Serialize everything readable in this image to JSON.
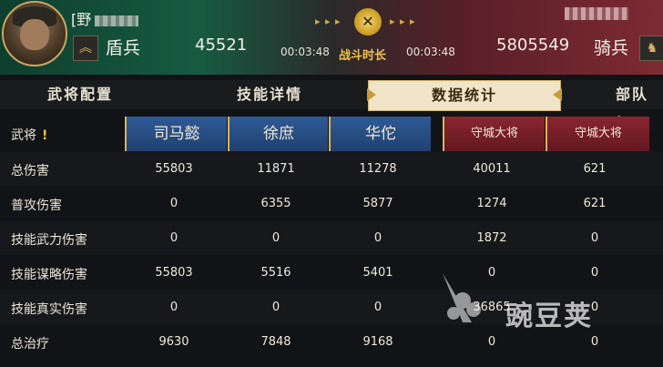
{
  "player_left": {
    "name_visible": "[野",
    "troop_icon": "chevron-icon",
    "troop": "盾兵",
    "count": "45521",
    "timer": "00:03:48"
  },
  "player_right": {
    "troop": "骑兵",
    "count": "5805549",
    "timer": "00:03:48"
  },
  "battle": {
    "label": "战斗时长",
    "arrows_left": "▸ ▸ ▸",
    "arrows_right": "▸ ▸ ▸",
    "icon": "crossed-swords-icon",
    "icon_glyph": "✕"
  },
  "tabs": [
    {
      "label": "武将配置",
      "active": false
    },
    {
      "label": "技能详情",
      "active": false
    },
    {
      "label": "数据统计",
      "active": true
    },
    {
      "label": "部队加",
      "active": false
    }
  ],
  "table": {
    "header_label": "武将",
    "header_mark": "!",
    "generals": [
      "司马懿",
      "徐庶",
      "华佗",
      "守城大将",
      "守城大将"
    ],
    "rows": [
      {
        "label": "总伤害",
        "values": [
          "55803",
          "11871",
          "11278",
          "40011",
          "621"
        ]
      },
      {
        "label": "普攻伤害",
        "values": [
          "0",
          "6355",
          "5877",
          "1274",
          "621"
        ]
      },
      {
        "label": "技能武力伤害",
        "values": [
          "0",
          "0",
          "0",
          "1872",
          "0"
        ]
      },
      {
        "label": "技能谋略伤害",
        "values": [
          "55803",
          "5516",
          "5401",
          "0",
          "0"
        ]
      },
      {
        "label": "技能真实伤害",
        "values": [
          "0",
          "0",
          "0",
          "36865",
          "0"
        ]
      },
      {
        "label": "总治疗",
        "values": [
          "9630",
          "7848",
          "9168",
          "0",
          "0"
        ]
      }
    ]
  },
  "watermark": {
    "text": "豌豆荚",
    "icon": "peapod-logo-icon"
  },
  "colors": {
    "left_team": "#175b43",
    "right_team": "#7d2a34",
    "accent": "#d9b45c",
    "blue_header": "#2f5a96",
    "red_header": "#8a2530"
  }
}
